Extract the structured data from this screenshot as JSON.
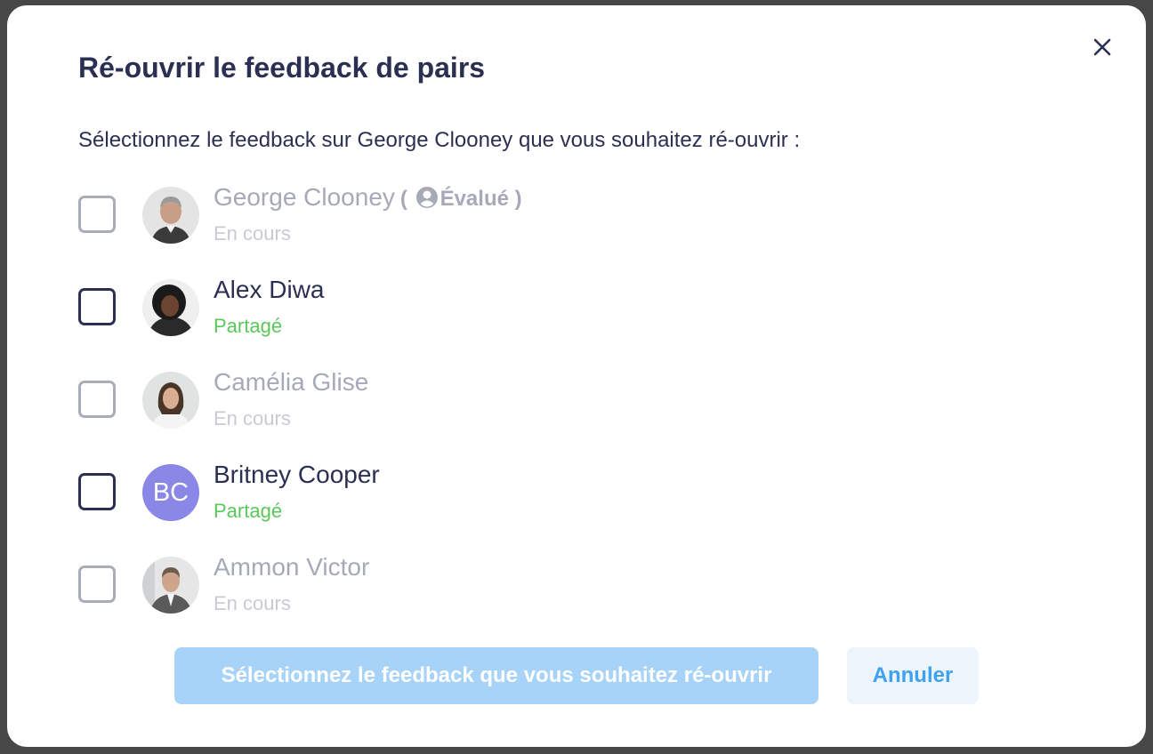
{
  "modal": {
    "title": "Ré-ouvrir le feedback de pairs",
    "subtitle": "Sélectionnez le feedback sur George Clooney que vous souhaitez ré-ouvrir :",
    "close_icon": "close-icon",
    "evaluated_tag": "( Évalué )",
    "evaluated_tag_open": "(",
    "evaluated_tag_label": "Évalué",
    "evaluated_tag_close": ")",
    "evaluated_icon": "user-circle-icon",
    "people": [
      {
        "name": "George Clooney",
        "status": "En cours",
        "checked": false,
        "avatar": "photo"
      },
      {
        "name": "Alex Diwa",
        "status": "Partagé",
        "checked": false,
        "avatar": "photo"
      },
      {
        "name": "Camélia Glise",
        "status": "En cours",
        "checked": false,
        "avatar": "photo"
      },
      {
        "name": "Britney Cooper",
        "status": "Partagé",
        "checked": false,
        "avatar": "initials",
        "initials": "BC"
      },
      {
        "name": "Ammon Victor",
        "status": "En cours",
        "checked": false,
        "avatar": "photo"
      }
    ],
    "primary_button": "Sélectionnez le feedback que vous souhaitez ré-ouvrir",
    "cancel_button": "Annuler"
  },
  "colors": {
    "text_dark": "#2b3052",
    "text_muted": "#a6a9b7",
    "status_shared": "#5ac85a",
    "status_in_progress": "#c9cbd3",
    "primary_disabled": "#a8d3f8",
    "cancel_bg": "#ecf4fc",
    "cancel_text": "#3fa2ee",
    "initials_avatar": "#8a87e6"
  }
}
